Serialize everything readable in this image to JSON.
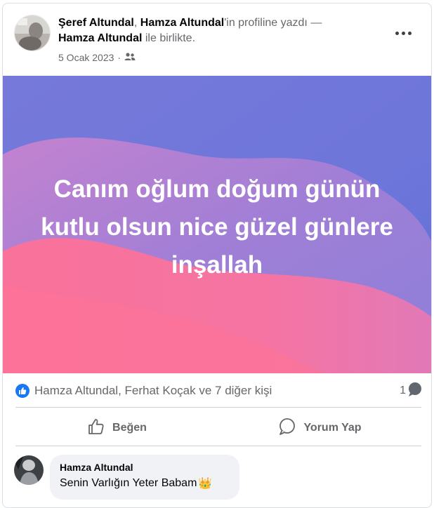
{
  "post": {
    "author": "Şeref Altundal",
    "comma": ",",
    "target": "Hamza Altundal",
    "wrote_text": "'in profiline yazdı —",
    "with_name": "Hamza Altundal",
    "with_text": "ile birlikte.",
    "date": "5 Ocak 2023",
    "date_sep": "·",
    "audience_icon": "friends-icon",
    "more_icon": "ellipsis-icon"
  },
  "banner": {
    "text": "Canım oğlum doğum günün kutlu olsun nice güzel günlere inşallah",
    "colors": [
      "#6b74d8",
      "#f9709b"
    ]
  },
  "reactions": {
    "icon": "like-icon",
    "names": "Hamza Altundal, Ferhat Koçak ve 7 diğer kişi",
    "comment_count": "1",
    "comment_icon": "comment-bubble-icon"
  },
  "actions": {
    "like_label": "Beğen",
    "comment_label": "Yorum Yap"
  },
  "comment": {
    "author": "Hamza Altundal",
    "text": "Senin Varlığın Yeter Babam",
    "emoji": "👑"
  },
  "accent": "#1877f2"
}
